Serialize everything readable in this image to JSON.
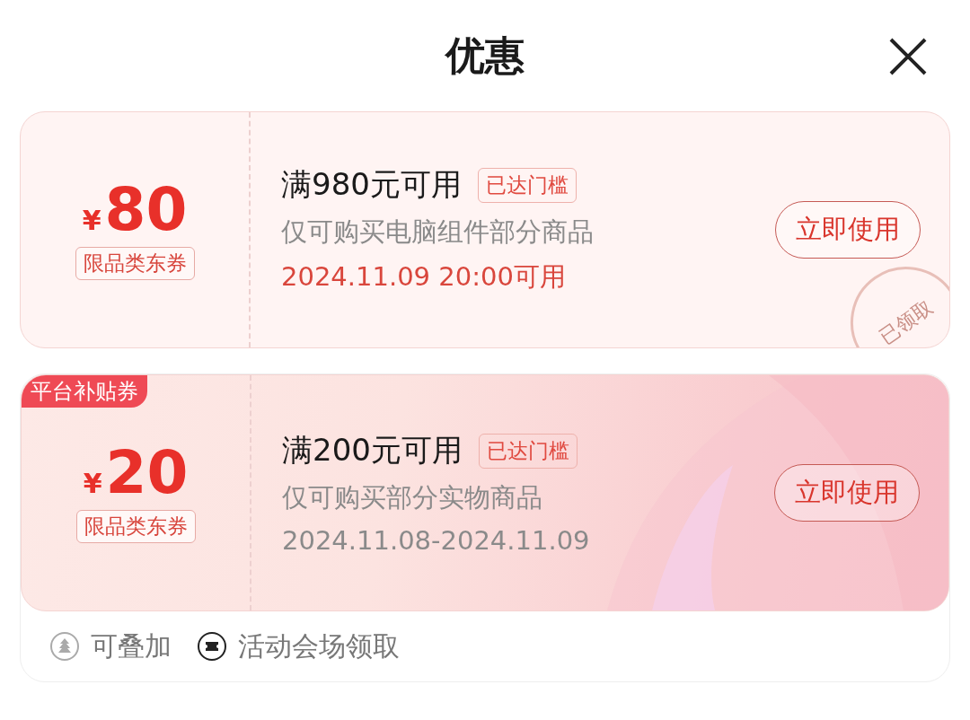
{
  "title": "优惠",
  "coupons": [
    {
      "amount": "80",
      "currency": "¥",
      "scope_tag": "限品类东券",
      "condition": "满980元可用",
      "threshold": "已达门槛",
      "description": "仅可购买电脑组件部分商品",
      "validity": "2024.11.09 20:00可用",
      "validity_highlight": true,
      "button": "立即使用",
      "stamp": "已领取",
      "kind": "plain"
    },
    {
      "tag": "平台补贴券",
      "amount": "20",
      "currency": "¥",
      "scope_tag": "限品类东券",
      "condition": "满200元可用",
      "threshold": "已达门槛",
      "description": "仅可购买部分实物商品",
      "validity": "2024.11.08-2024.11.09",
      "validity_highlight": false,
      "button": "立即使用",
      "kind": "gradient"
    }
  ],
  "footer": [
    {
      "kind": "stack",
      "label": "可叠加"
    },
    {
      "kind": "venue",
      "label": "活动会场领取"
    }
  ]
}
